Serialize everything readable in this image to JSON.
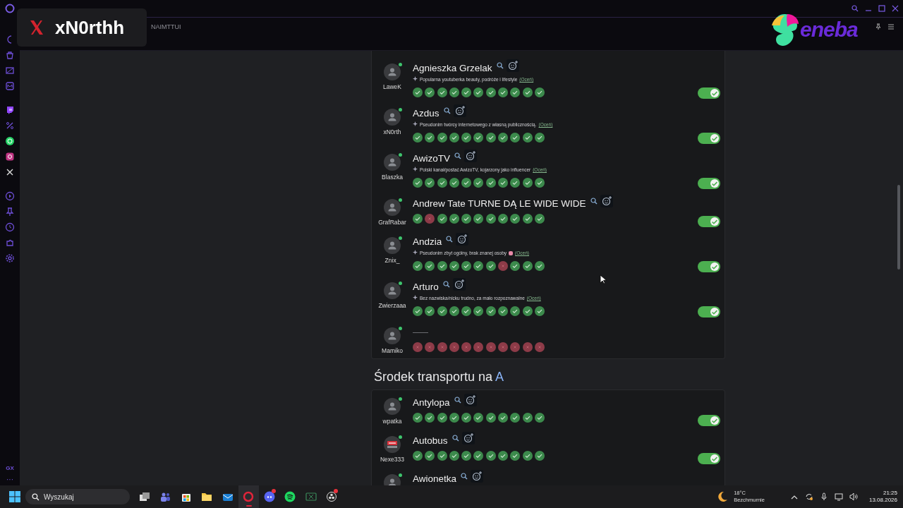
{
  "overlay": {
    "handle": "xN0rthh",
    "sponsor": "eneba"
  },
  "browser": {
    "address_text": "NAIMTTUI"
  },
  "sidebar": {
    "footer_label": "GX",
    "more": "···"
  },
  "sections": [
    {
      "rows": [
        {
          "username": "LaweK",
          "custom_avatar": false,
          "online": true,
          "name": "Agnieszka Grzelak",
          "note": "Popularna youtuberka beauty, podróże i lifestyle",
          "rate_link": "(Oceń)",
          "votes": [
            true,
            true,
            true,
            true,
            true,
            true,
            true,
            true,
            true,
            true,
            true
          ],
          "accepted": true
        },
        {
          "username": "xN0rth",
          "custom_avatar": false,
          "online": true,
          "name": "Azdus",
          "note": "Pseudonim twórcy internetowego z własną publicznością.",
          "rate_link": "(Oceń)",
          "votes": [
            true,
            true,
            true,
            true,
            true,
            true,
            true,
            true,
            true,
            true,
            true
          ],
          "accepted": true
        },
        {
          "username": "Blaszka",
          "custom_avatar": false,
          "online": true,
          "name": "AwizoTV",
          "note": "Polski kanał/postać AwizoTV, kojarzony jako influencer",
          "rate_link": "(Oceń)",
          "votes": [
            true,
            true,
            true,
            true,
            true,
            true,
            true,
            true,
            true,
            true,
            true
          ],
          "accepted": true
        },
        {
          "username": "GrafRabar",
          "custom_avatar": false,
          "online": true,
          "name": "Andrew Tate TURNE DĄ LE WIDE WIDE",
          "votes": [
            true,
            false,
            true,
            true,
            true,
            true,
            true,
            true,
            true,
            true,
            true
          ],
          "accepted": true
        },
        {
          "username": "Znix_",
          "custom_avatar": false,
          "online": true,
          "name": "Andzia",
          "note": "Pseudonim zbyt ogólny, brak znanej osoby",
          "note_icon": true,
          "rate_link": "(Oceń)",
          "votes": [
            true,
            true,
            true,
            true,
            true,
            true,
            true,
            false,
            true,
            true,
            true
          ],
          "accepted": true
        },
        {
          "username": "Zwierzaaa",
          "custom_avatar": false,
          "online": true,
          "name": "Arturo",
          "note": "Bez nazwiska/nicku trudno, za mało rozpoznawalne",
          "rate_link": "(Oceń)",
          "votes": [
            true,
            true,
            true,
            true,
            true,
            true,
            true,
            true,
            true,
            true,
            true
          ],
          "accepted": true
        },
        {
          "username": "Mamiko",
          "custom_avatar": false,
          "online": true,
          "votes": [
            false,
            false,
            false,
            false,
            false,
            false,
            false,
            false,
            false,
            false,
            false
          ]
        }
      ]
    },
    {
      "heading": "Środek transportu na ",
      "heading_letter": "A",
      "rows": [
        {
          "username": "wpatka",
          "custom_avatar": false,
          "online": true,
          "name": "Antylopa",
          "votes": [
            true,
            true,
            true,
            true,
            true,
            true,
            true,
            true,
            true,
            true,
            true
          ],
          "accepted": true
        },
        {
          "username": "Nexe333",
          "custom_avatar": true,
          "online": true,
          "name": "Autobus",
          "votes": [
            true,
            true,
            true,
            true,
            true,
            true,
            true,
            true,
            true,
            true,
            true
          ],
          "accepted": true
        },
        {
          "custom_avatar": false,
          "online": true,
          "name": "Awionetka"
        }
      ]
    }
  ],
  "taskbar": {
    "search_placeholder": "Wyszukaj",
    "apps": [
      {
        "kind": "taskview",
        "active": false,
        "badge": false
      },
      {
        "kind": "teams",
        "active": false,
        "badge": false
      },
      {
        "kind": "store",
        "active": false,
        "badge": false
      },
      {
        "kind": "files",
        "active": false,
        "badge": false
      },
      {
        "kind": "mail",
        "active": false,
        "badge": false
      },
      {
        "kind": "opera",
        "active": true,
        "badge": false
      },
      {
        "kind": "discord",
        "active": false,
        "badge": true
      },
      {
        "kind": "spotify",
        "active": false,
        "badge": false
      },
      {
        "kind": "excel",
        "active": false,
        "badge": false
      },
      {
        "kind": "obs",
        "active": false,
        "badge": true
      }
    ],
    "temperature": "18°C",
    "weather": "Bezchmurnie",
    "time": "21:25",
    "date": "13.08.2026"
  }
}
